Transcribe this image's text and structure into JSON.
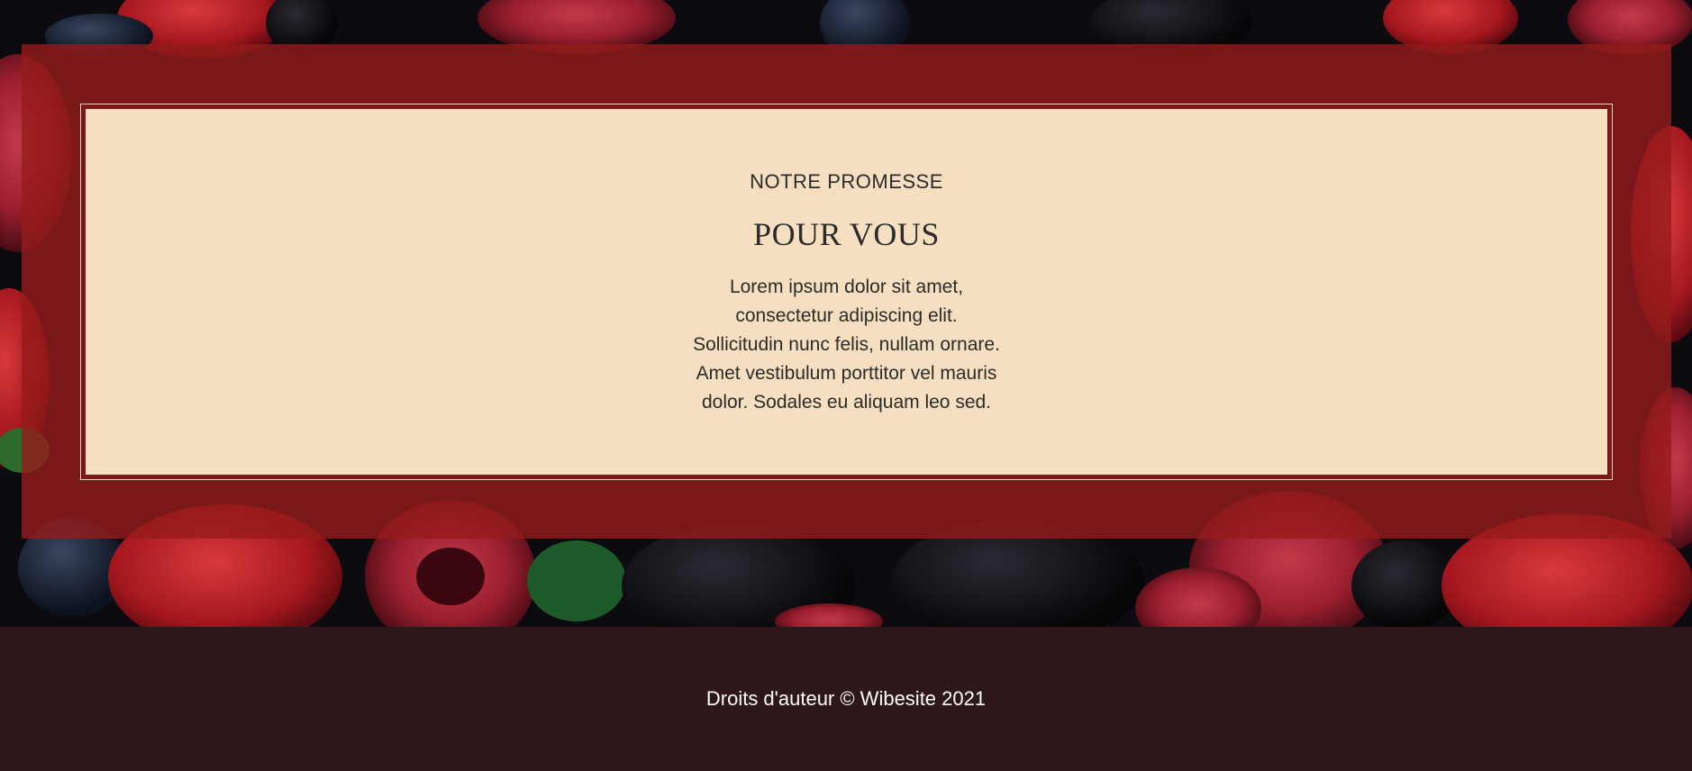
{
  "promise": {
    "eyebrow": "NOTRE PROMESSE",
    "title": "POUR VOUS",
    "body_lines": [
      "Lorem ipsum dolor sit amet,",
      "consectetur adipiscing elit.",
      "Sollicitudin nunc felis, nullam ornare.",
      "Amet vestibulum porttitor vel mauris",
      "dolor. Sodales eu aliquam leo sed."
    ]
  },
  "footer": {
    "copyright": "Droits d'auteur © Wibesite 2021"
  },
  "colors": {
    "panel_red": "#961c1c",
    "card_beige": "#f5dfc0",
    "footer_bg": "#2e1718"
  }
}
